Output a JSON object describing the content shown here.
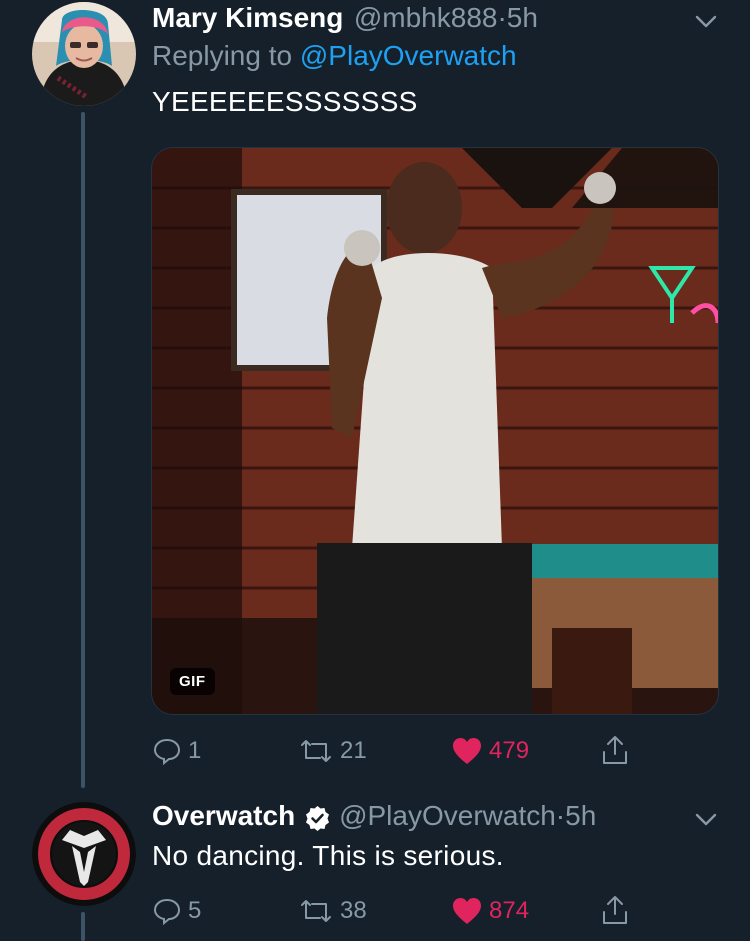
{
  "tweet1": {
    "name": "Mary Kimseng",
    "handle": "@mbhk888",
    "separator": "·",
    "time": "5h",
    "replying_label": "Replying to",
    "replying_to": "@PlayOverwatch",
    "text": "YEEEEEESSSSSSS",
    "media": {
      "badge": "GIF",
      "icon": "gif-media"
    },
    "actions": {
      "reply_count": "1",
      "retweet_count": "21",
      "like_count": "479",
      "liked": true
    }
  },
  "tweet2": {
    "name": "Overwatch",
    "verified": true,
    "handle": "@PlayOverwatch",
    "separator": "·",
    "time": "5h",
    "text": "No dancing. This is serious.",
    "actions": {
      "reply_count": "5",
      "retweet_count": "38",
      "like_count": "874",
      "liked": true
    }
  },
  "colors": {
    "background": "#15202b",
    "text": "#ffffff",
    "muted": "#8899a6",
    "link": "#1da1f2",
    "like": "#e0245e",
    "thread_line": "#3d5466"
  }
}
